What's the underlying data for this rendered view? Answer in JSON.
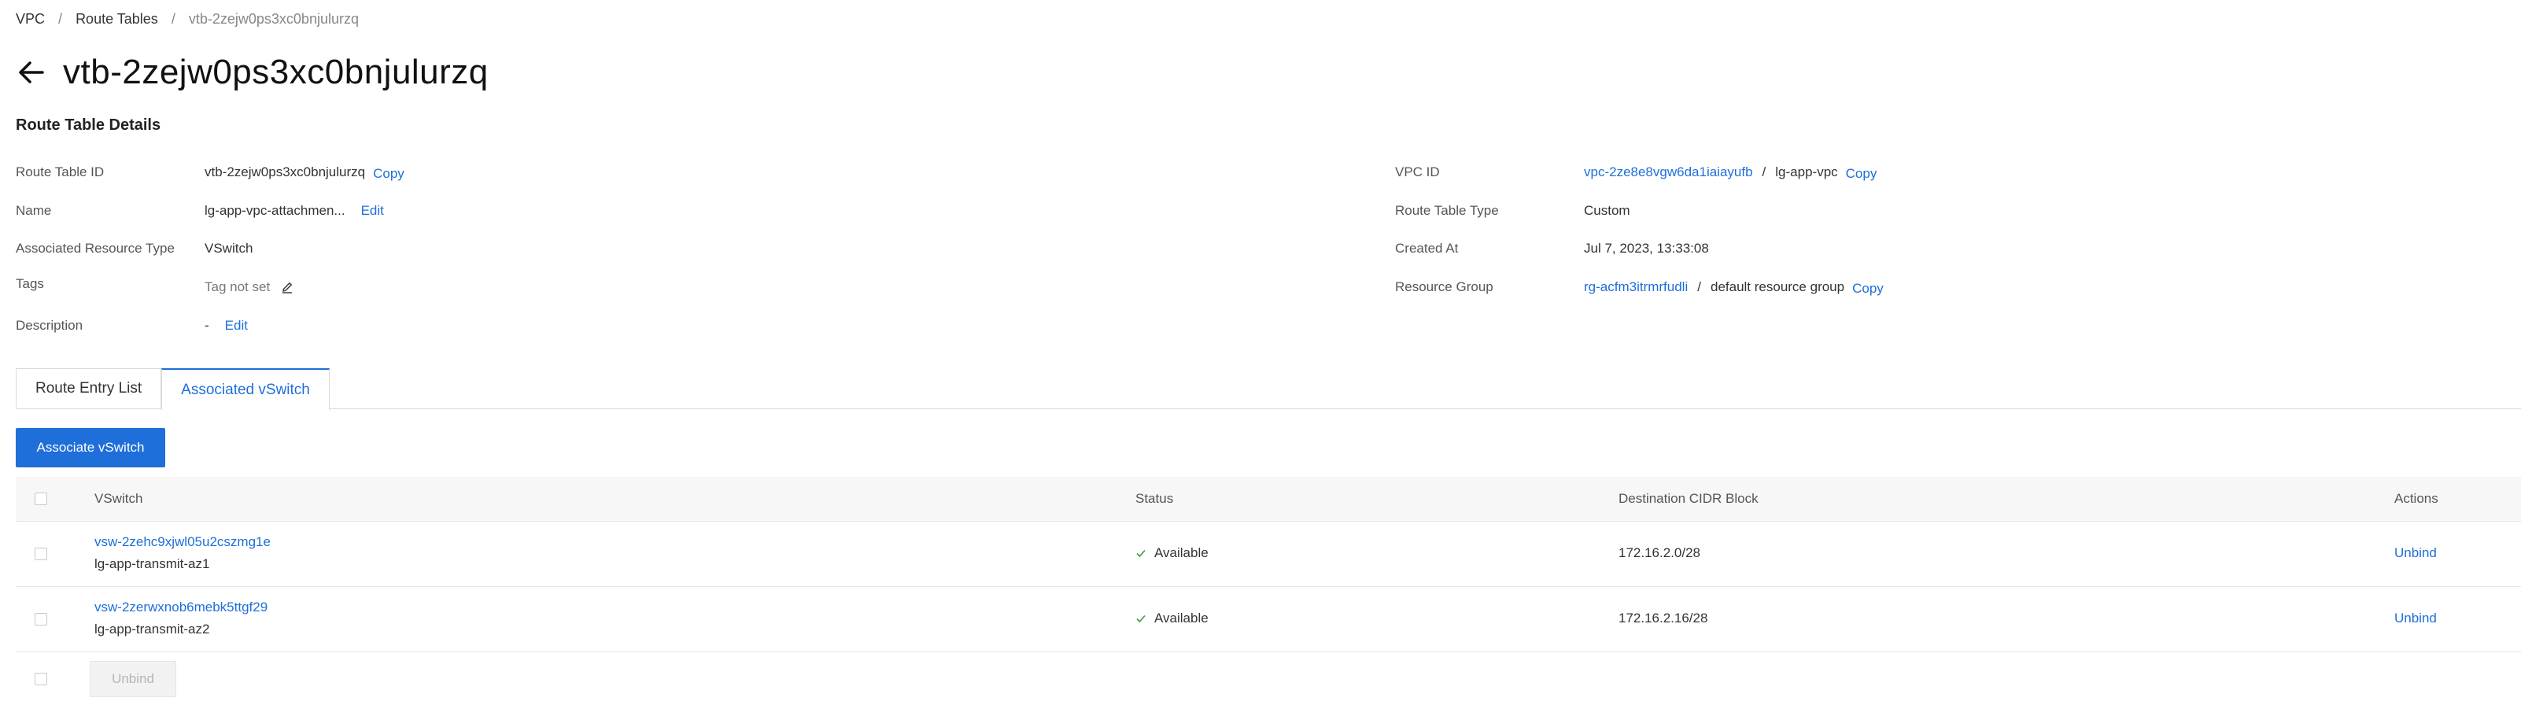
{
  "breadcrumb": {
    "items": [
      "VPC",
      "Route Tables"
    ],
    "current": "vtb-2zejw0ps3xc0bnjulurzq",
    "separator": "/"
  },
  "page_title": "vtb-2zejw0ps3xc0bnjulurzq",
  "section_title": "Route Table Details",
  "details_left": {
    "route_table_id": {
      "label": "Route Table ID",
      "value": "vtb-2zejw0ps3xc0bnjulurzq",
      "copy": "Copy"
    },
    "name": {
      "label": "Name",
      "value": "lg-app-vpc-attachmen...",
      "edit": "Edit"
    },
    "resource_type": {
      "label": "Associated Resource Type",
      "value": "VSwitch"
    },
    "tags": {
      "label": "Tags",
      "value": "Tag not set"
    },
    "description": {
      "label": "Description",
      "value": "-",
      "edit": "Edit"
    }
  },
  "details_right": {
    "vpc_id": {
      "label": "VPC ID",
      "link": "vpc-2ze8e8vgw6da1iaiayufb",
      "sep": "/",
      "name": "lg-app-vpc",
      "copy": "Copy"
    },
    "type": {
      "label": "Route Table Type",
      "value": "Custom"
    },
    "created": {
      "label": "Created At",
      "value": "Jul 7, 2023, 13:33:08"
    },
    "resource_group": {
      "label": "Resource Group",
      "link": "rg-acfm3itrmrfudli",
      "sep": "/",
      "name": "default resource group",
      "copy": "Copy"
    }
  },
  "tabs": [
    "Route Entry List",
    "Associated vSwitch"
  ],
  "active_tab": 1,
  "associate_button": "Associate vSwitch",
  "table": {
    "headers": {
      "vswitch": "VSwitch",
      "status": "Status",
      "cidr": "Destination CIDR Block",
      "actions": "Actions"
    },
    "rows": [
      {
        "id": "vsw-2zehc9xjwl05u2cszmg1e",
        "name": "lg-app-transmit-az1",
        "status": "Available",
        "cidr": "172.16.2.0/28",
        "action": "Unbind"
      },
      {
        "id": "vsw-2zerwxnob6mebk5ttgf29",
        "name": "lg-app-transmit-az2",
        "status": "Available",
        "cidr": "172.16.2.16/28",
        "action": "Unbind"
      }
    ]
  },
  "footer_unbind": "Unbind",
  "colors": {
    "accent": "#1e6fd9",
    "status_ok": "#3a9a3a",
    "header_bg": "#f7f7f7"
  }
}
